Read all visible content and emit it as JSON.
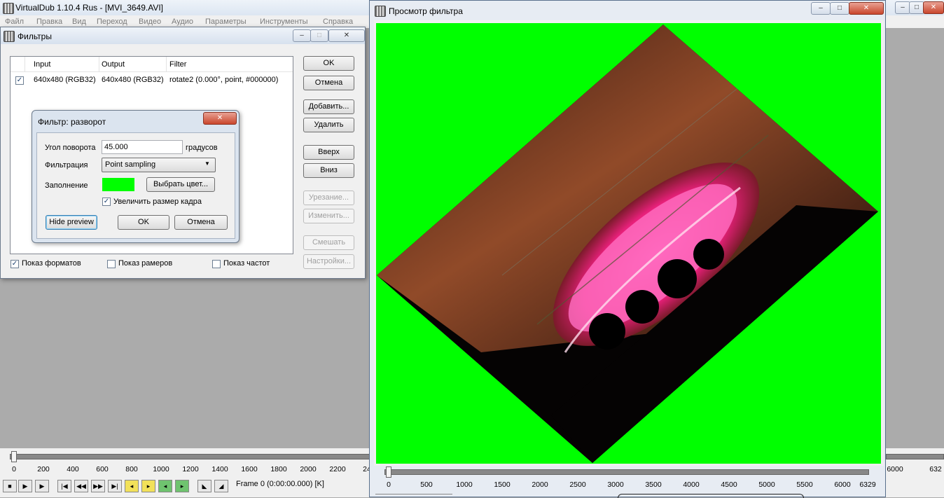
{
  "main_window": {
    "title": "VirtualDub 1.10.4 Rus - [MVI_3649.AVI]",
    "menu": [
      "Файл",
      "Правка",
      "Вид",
      "Переход",
      "Видео",
      "Аудио",
      "Параметры",
      "Инструменты",
      "Справка"
    ]
  },
  "filters_dialog": {
    "title": "Фильтры",
    "columns": [
      "Input",
      "Output",
      "Filter"
    ],
    "rows": [
      {
        "checked": true,
        "input": "640x480 (RGB32)",
        "output": "640x480 (RGB32)",
        "filter": "rotate2 (0.000°, point, #000000)"
      }
    ],
    "buttons": {
      "ok": "OK",
      "cancel": "Отмена",
      "add": "Добавить...",
      "delete": "Удалить",
      "up": "Вверх",
      "down": "Вниз",
      "crop": "Урезание...",
      "edit": "Изменить...",
      "blend": "Смешать",
      "settings": "Настройки..."
    },
    "checkboxes": {
      "show_formats": {
        "label": "Показ форматов",
        "checked": true
      },
      "show_sizes": {
        "label": "Показ рамеров",
        "checked": false
      },
      "show_rates": {
        "label": "Показ частот",
        "checked": false
      }
    }
  },
  "rotate_dialog": {
    "title": "Фильтр: разворот",
    "angle_label": "Угол поворота",
    "angle_value": "45.000",
    "angle_unit": "градусов",
    "filter_label": "Фильтрация",
    "filter_value": "Point sampling",
    "fill_label": "Заполнение",
    "fill_color": "#00ff00",
    "pick_color_button": "Выбрать цвет...",
    "expand_label": "Увеличить размер кадра",
    "expand_checked": true,
    "hide_preview_button": "Hide preview",
    "ok_button": "OK",
    "cancel_button": "Отмена"
  },
  "preview_window": {
    "title": "Просмотр фильтра",
    "ticks": [
      "0",
      "500",
      "1000",
      "1500",
      "2000",
      "2500",
      "3000",
      "3500",
      "4000",
      "4500",
      "5000",
      "5500",
      "6000",
      "6329"
    ]
  },
  "main_timeline": {
    "ticks": [
      "0",
      "200",
      "400",
      "600",
      "800",
      "1000",
      "1200",
      "1400",
      "1600",
      "1800",
      "2000",
      "2200",
      "24"
    ],
    "right_ticks": [
      "6000",
      "632"
    ],
    "frame_status": "Frame 0 (0:00:00.000) [K]"
  }
}
